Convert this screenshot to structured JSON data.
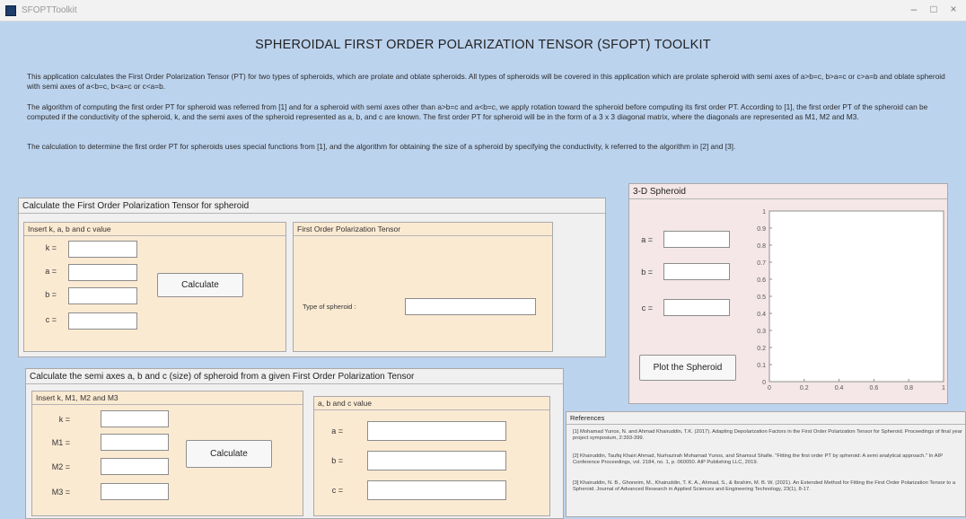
{
  "window": {
    "title": "SFOPTToolkit",
    "minimize_glyph": "–",
    "maximize_glyph": "□",
    "close_glyph": "×"
  },
  "main_title": "SPHEROIDAL FIRST ORDER POLARIZATION TENSOR (SFOPT) TOOLKIT",
  "description": [
    "This application calculates the First Order Polarization Tensor (PT) for two types of spheroids, which are prolate and oblate spheroids. All types of spheroids will be covered in this application which are prolate spheroid with semi axes of a>b=c, b>a=c or c>a=b and oblate spheroid with semi axes of a<b=c, b<a=c or c<a=b.",
    "The algorithm of computing the first order PT for spheroid was referred from [1] and for a spheroid with semi axes other than a>b=c and a<b=c, we apply rotation toward the spheroid before computing its first order PT. According to [1], the first order PT of the spheroid can be computed if the conductivity of the spheroid, k, and the semi axes of the spheroid represented as a, b, and c are known. The first order PT for spheroid will be in the form of a 3 x 3 diagonal matrix, where the diagonals are represented as M1, M2 and M3.",
    "The calculation to determine the first order PT for spheroids uses special functions from [1], and the algorithm for obtaining the size of a spheroid by specifying the conductivity, k referred to the algorithm in [2] and [3]."
  ],
  "calc_pt_panel": {
    "title": "Calculate the First Order Polarization Tensor for spheroid",
    "input_group": {
      "title": "Insert k, a, b and c value",
      "fields": [
        {
          "label": "k =",
          "value": ""
        },
        {
          "label": "a =",
          "value": ""
        },
        {
          "label": "b =",
          "value": ""
        },
        {
          "label": "c =",
          "value": ""
        }
      ]
    },
    "calculate_label": "Calculate",
    "result_group": {
      "title": "First Order Polarization Tensor",
      "type_label": "Type of spheroid :",
      "type_value": ""
    }
  },
  "calc_size_panel": {
    "title": "Calculate the semi axes a, b and c (size) of spheroid from a given First Order Polarization Tensor",
    "input_group": {
      "title": "Insert k, M1, M2 and M3",
      "fields": [
        {
          "label": "k =",
          "value": ""
        },
        {
          "label": "M1 =",
          "value": ""
        },
        {
          "label": "M2 =",
          "value": ""
        },
        {
          "label": "M3 =",
          "value": ""
        }
      ]
    },
    "calculate_label": "Calculate",
    "result_group": {
      "title": "a, b and c value",
      "fields": [
        {
          "label": "a =",
          "value": ""
        },
        {
          "label": "b =",
          "value": ""
        },
        {
          "label": "c =",
          "value": ""
        }
      ]
    }
  },
  "spheroid_panel": {
    "title": "3-D Spheroid",
    "fields": [
      {
        "label": "a =",
        "value": ""
      },
      {
        "label": "b =",
        "value": ""
      },
      {
        "label": "c =",
        "value": ""
      }
    ],
    "plot_label": "Plot the Spheroid"
  },
  "chart_data": {
    "type": "line",
    "title": "",
    "xlabel": "",
    "ylabel": "",
    "xlim": [
      0,
      1
    ],
    "ylim": [
      0,
      1
    ],
    "x_ticks": [
      "0",
      "0.2",
      "0.4",
      "0.6",
      "0.8",
      "1"
    ],
    "y_ticks": [
      "0",
      "0.1",
      "0.2",
      "0.3",
      "0.4",
      "0.5",
      "0.6",
      "0.7",
      "0.8",
      "0.9",
      "1"
    ],
    "series": [],
    "grid": false
  },
  "references": {
    "title": "References",
    "items": [
      "[1] Mohamad Yunos, N. and Ahmad Khairuddin, T.K. (2017). Adapting Depolarization Factors in the First Order Polarization Tensor for Spheroid. Proceedings of final year project symposium, 2:393-399.",
      "[2] Khairuddin, Taufiq Khairi Ahmad, Nurhazirah Mohamad Yunos, and Shamsul Shafie. \"Fitting the first order PT by spheroid: A semi analytical approach.\" In AIP Conference Proceedings, vol. 2184, no. 1, p. 060050. AIP Publishing LLC, 2019.",
      "[3] Khairuddin, N. B., Ghoneim, M., Khairuddin, T. K. A., Ahmad, S., & Ibrahim, M. B. W. (2021). An Extended Method for Fitting the First Order Polarization Tensor to a Spheroid. Journal of Advanced Research in Applied Sciences and Engineering Technology, 23(1), 8-17."
    ]
  }
}
